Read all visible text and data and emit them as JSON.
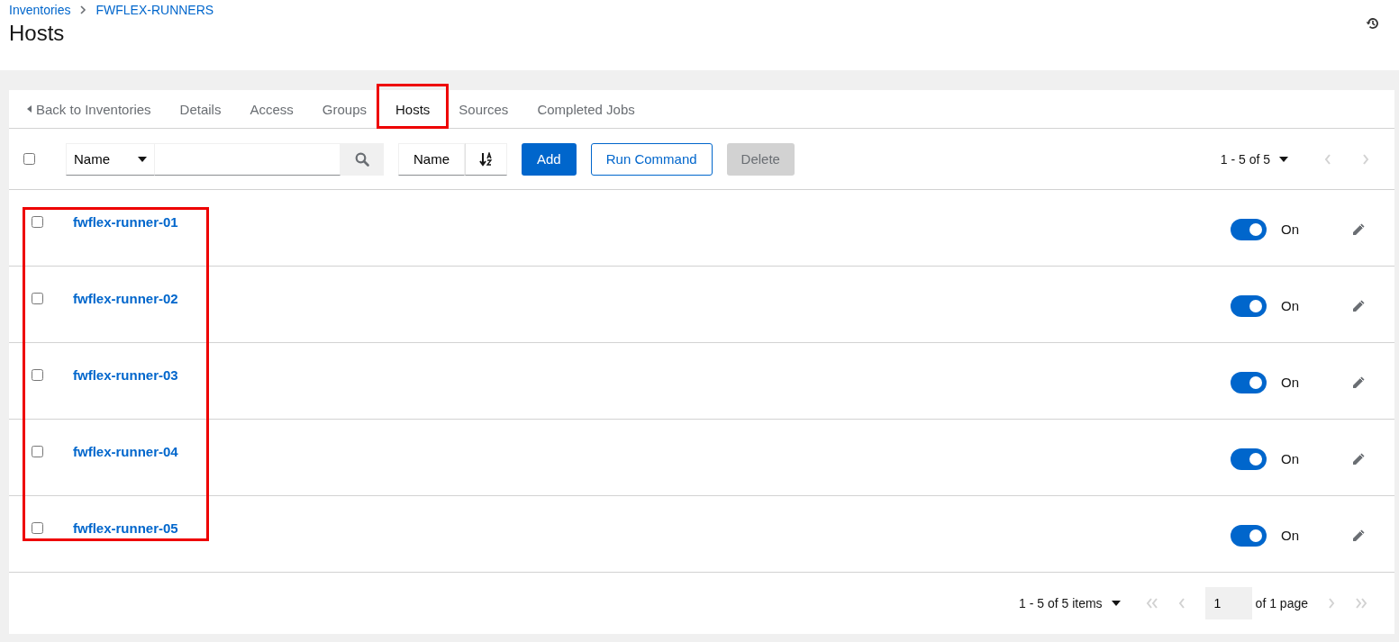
{
  "breadcrumb": [
    "Inventories",
    "FWFLEX-RUNNERS"
  ],
  "title": "Hosts",
  "back_link": "Back to Inventories",
  "tabs": [
    {
      "label": "Details",
      "selected": false,
      "highlighted": false
    },
    {
      "label": "Access",
      "selected": false,
      "highlighted": false
    },
    {
      "label": "Groups",
      "selected": false,
      "highlighted": false
    },
    {
      "label": "Hosts",
      "selected": true,
      "highlighted": true
    },
    {
      "label": "Sources",
      "selected": false,
      "highlighted": false
    },
    {
      "label": "Completed Jobs",
      "selected": false,
      "highlighted": false
    }
  ],
  "toolbar": {
    "select_all_checked": false,
    "filter_key": "Name",
    "sort_key": "Name",
    "add": "Add",
    "run_command": "Run Command",
    "delete": "Delete",
    "delete_disabled": true,
    "page_range": "1 - 5 of 5"
  },
  "hosts_highlighted": true,
  "hosts": [
    {
      "name": "fwflex-runner-01",
      "checked": false,
      "on": true,
      "toggle_label": "On"
    },
    {
      "name": "fwflex-runner-02",
      "checked": false,
      "on": true,
      "toggle_label": "On"
    },
    {
      "name": "fwflex-runner-03",
      "checked": false,
      "on": true,
      "toggle_label": "On"
    },
    {
      "name": "fwflex-runner-04",
      "checked": false,
      "on": true,
      "toggle_label": "On"
    },
    {
      "name": "fwflex-runner-05",
      "checked": false,
      "on": true,
      "toggle_label": "On"
    }
  ],
  "pagination": {
    "items": "1 - 5 of 5 items",
    "page": "1",
    "of_pages": "of 1 page"
  }
}
